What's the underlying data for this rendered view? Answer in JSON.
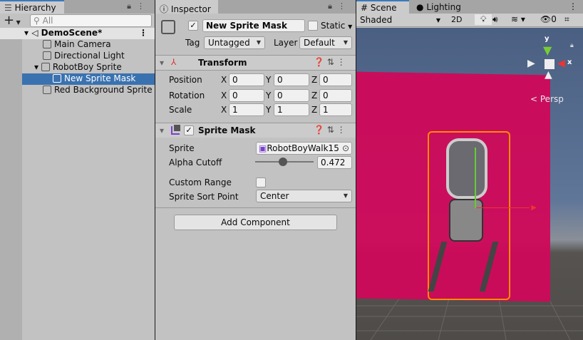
{
  "hierarchy": {
    "tab": "Hierarchy",
    "search_placeholder": "All",
    "add": "+",
    "scene": "DemoScene*",
    "items": [
      "Main Camera",
      "Directional Light",
      "RobotBoy Sprite",
      "New Sprite Mask",
      "Red Background Sprite"
    ]
  },
  "inspector": {
    "tab": "Inspector",
    "object_name": "New Sprite Mask",
    "static_label": "Static",
    "tag_label": "Tag",
    "tag_value": "Untagged",
    "layer_label": "Layer",
    "layer_value": "Default",
    "transform": {
      "title": "Transform",
      "rows": [
        {
          "label": "Position",
          "x": "0",
          "y": "0",
          "z": "0"
        },
        {
          "label": "Rotation",
          "x": "0",
          "y": "0",
          "z": "0"
        },
        {
          "label": "Scale",
          "x": "1",
          "y": "1",
          "z": "1"
        }
      ]
    },
    "axis": {
      "x": "X",
      "y": "Y",
      "z": "Z"
    },
    "sprite_mask": {
      "title": "Sprite Mask",
      "sprite_label": "Sprite",
      "sprite_value": "RobotBoyWalk15",
      "alpha_label": "Alpha Cutoff",
      "alpha_value": "0.472",
      "alpha_fraction": 0.472,
      "custom_range_label": "Custom Range",
      "sort_label": "Sprite Sort Point",
      "sort_value": "Center"
    },
    "add_component": "Add Component"
  },
  "scene": {
    "tab": "Scene",
    "lighting_tab": "Lighting",
    "shading": "Shaded",
    "mode_2d": "2D",
    "hidden_count": "0",
    "persp": "Persp",
    "gizmo_x": "x",
    "gizmo_y": "y"
  },
  "colors": {
    "selection": "#3a72b0",
    "background_sprite": "#d0085a",
    "mask_outline": "#ff8a00"
  }
}
